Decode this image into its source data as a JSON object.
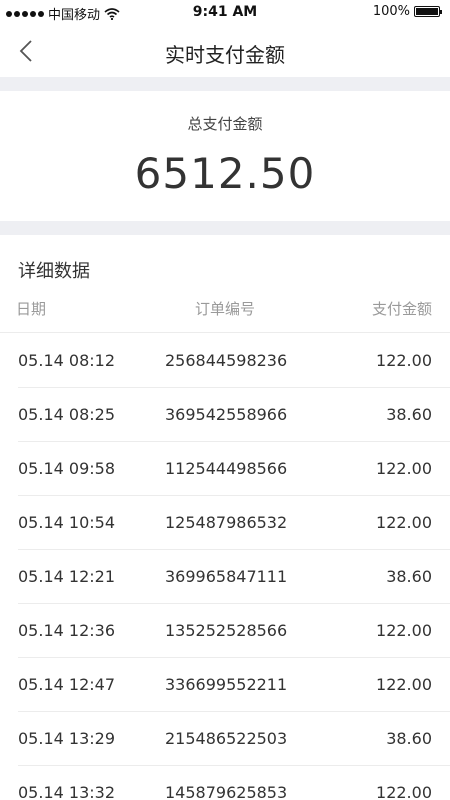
{
  "status_bar": {
    "carrier": "中国移动",
    "time": "9:41 AM",
    "battery": "100%",
    "battery_level": 1.0
  },
  "nav": {
    "title": "实时支付金额",
    "back_icon": "chevron-left-icon"
  },
  "summary": {
    "label": "总支付金额",
    "value": "6512.50"
  },
  "details": {
    "title": "详细数据",
    "columns": [
      "日期",
      "订单编号",
      "支付金额"
    ],
    "rows": [
      {
        "date": "05.14 08:12",
        "order": "256844598236",
        "amount": "122.00"
      },
      {
        "date": "05.14 08:25",
        "order": "369542558966",
        "amount": "38.60"
      },
      {
        "date": "05.14 09:58",
        "order": "112544498566",
        "amount": "122.00"
      },
      {
        "date": "05.14 10:54",
        "order": "125487986532",
        "amount": "122.00"
      },
      {
        "date": "05.14 12:21",
        "order": "369965847111",
        "amount": "38.60"
      },
      {
        "date": "05.14 12:36",
        "order": "135252528566",
        "amount": "122.00"
      },
      {
        "date": "05.14 12:47",
        "order": "336699552211",
        "amount": "122.00"
      },
      {
        "date": "05.14 13:29",
        "order": "215486522503",
        "amount": "38.60"
      },
      {
        "date": "05.14 13:32",
        "order": "145879625853",
        "amount": "122.00"
      }
    ]
  },
  "colors": {
    "separator": "#eeeff3",
    "text": "#333333",
    "muted": "#9a9a9a"
  }
}
